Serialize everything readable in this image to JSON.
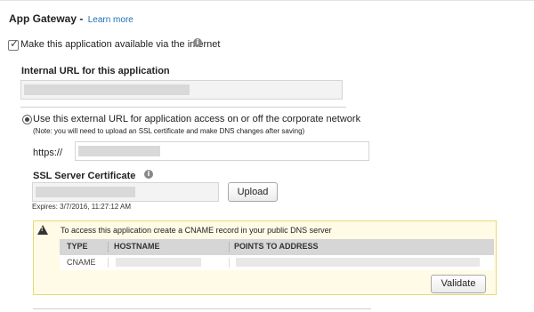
{
  "section": {
    "title": "App Gateway -",
    "learn_more": "Learn more"
  },
  "availability": {
    "checked": true,
    "label": "Make this application available via the internet"
  },
  "internal_url": {
    "label": "Internal URL for this application"
  },
  "external_url": {
    "option_label": "Use this external URL for application access on or off the corporate network",
    "note": "(Note: you will need to upload an SSL certificate and make DNS changes after saving)",
    "prefix": "https://"
  },
  "ssl": {
    "label": "SSL Server Certificate",
    "upload_label": "Upload",
    "expires": "Expires: 3/7/2016, 11:27:12 AM"
  },
  "dns": {
    "message": "To access this application create a CNAME record in your public DNS server",
    "columns": [
      "TYPE",
      "HOSTNAME",
      "POINTS TO ADDRESS"
    ],
    "rows": [
      {
        "type": "CNAME"
      }
    ],
    "validate_label": "Validate"
  },
  "icons": {
    "info": "info-icon",
    "warning": "warning-icon",
    "check": "check-icon"
  },
  "colors": {
    "link": "#1f6fb2",
    "panel_bg": "#fffbe6",
    "panel_border": "#e8d977",
    "table_header": "#d6d6d6"
  }
}
